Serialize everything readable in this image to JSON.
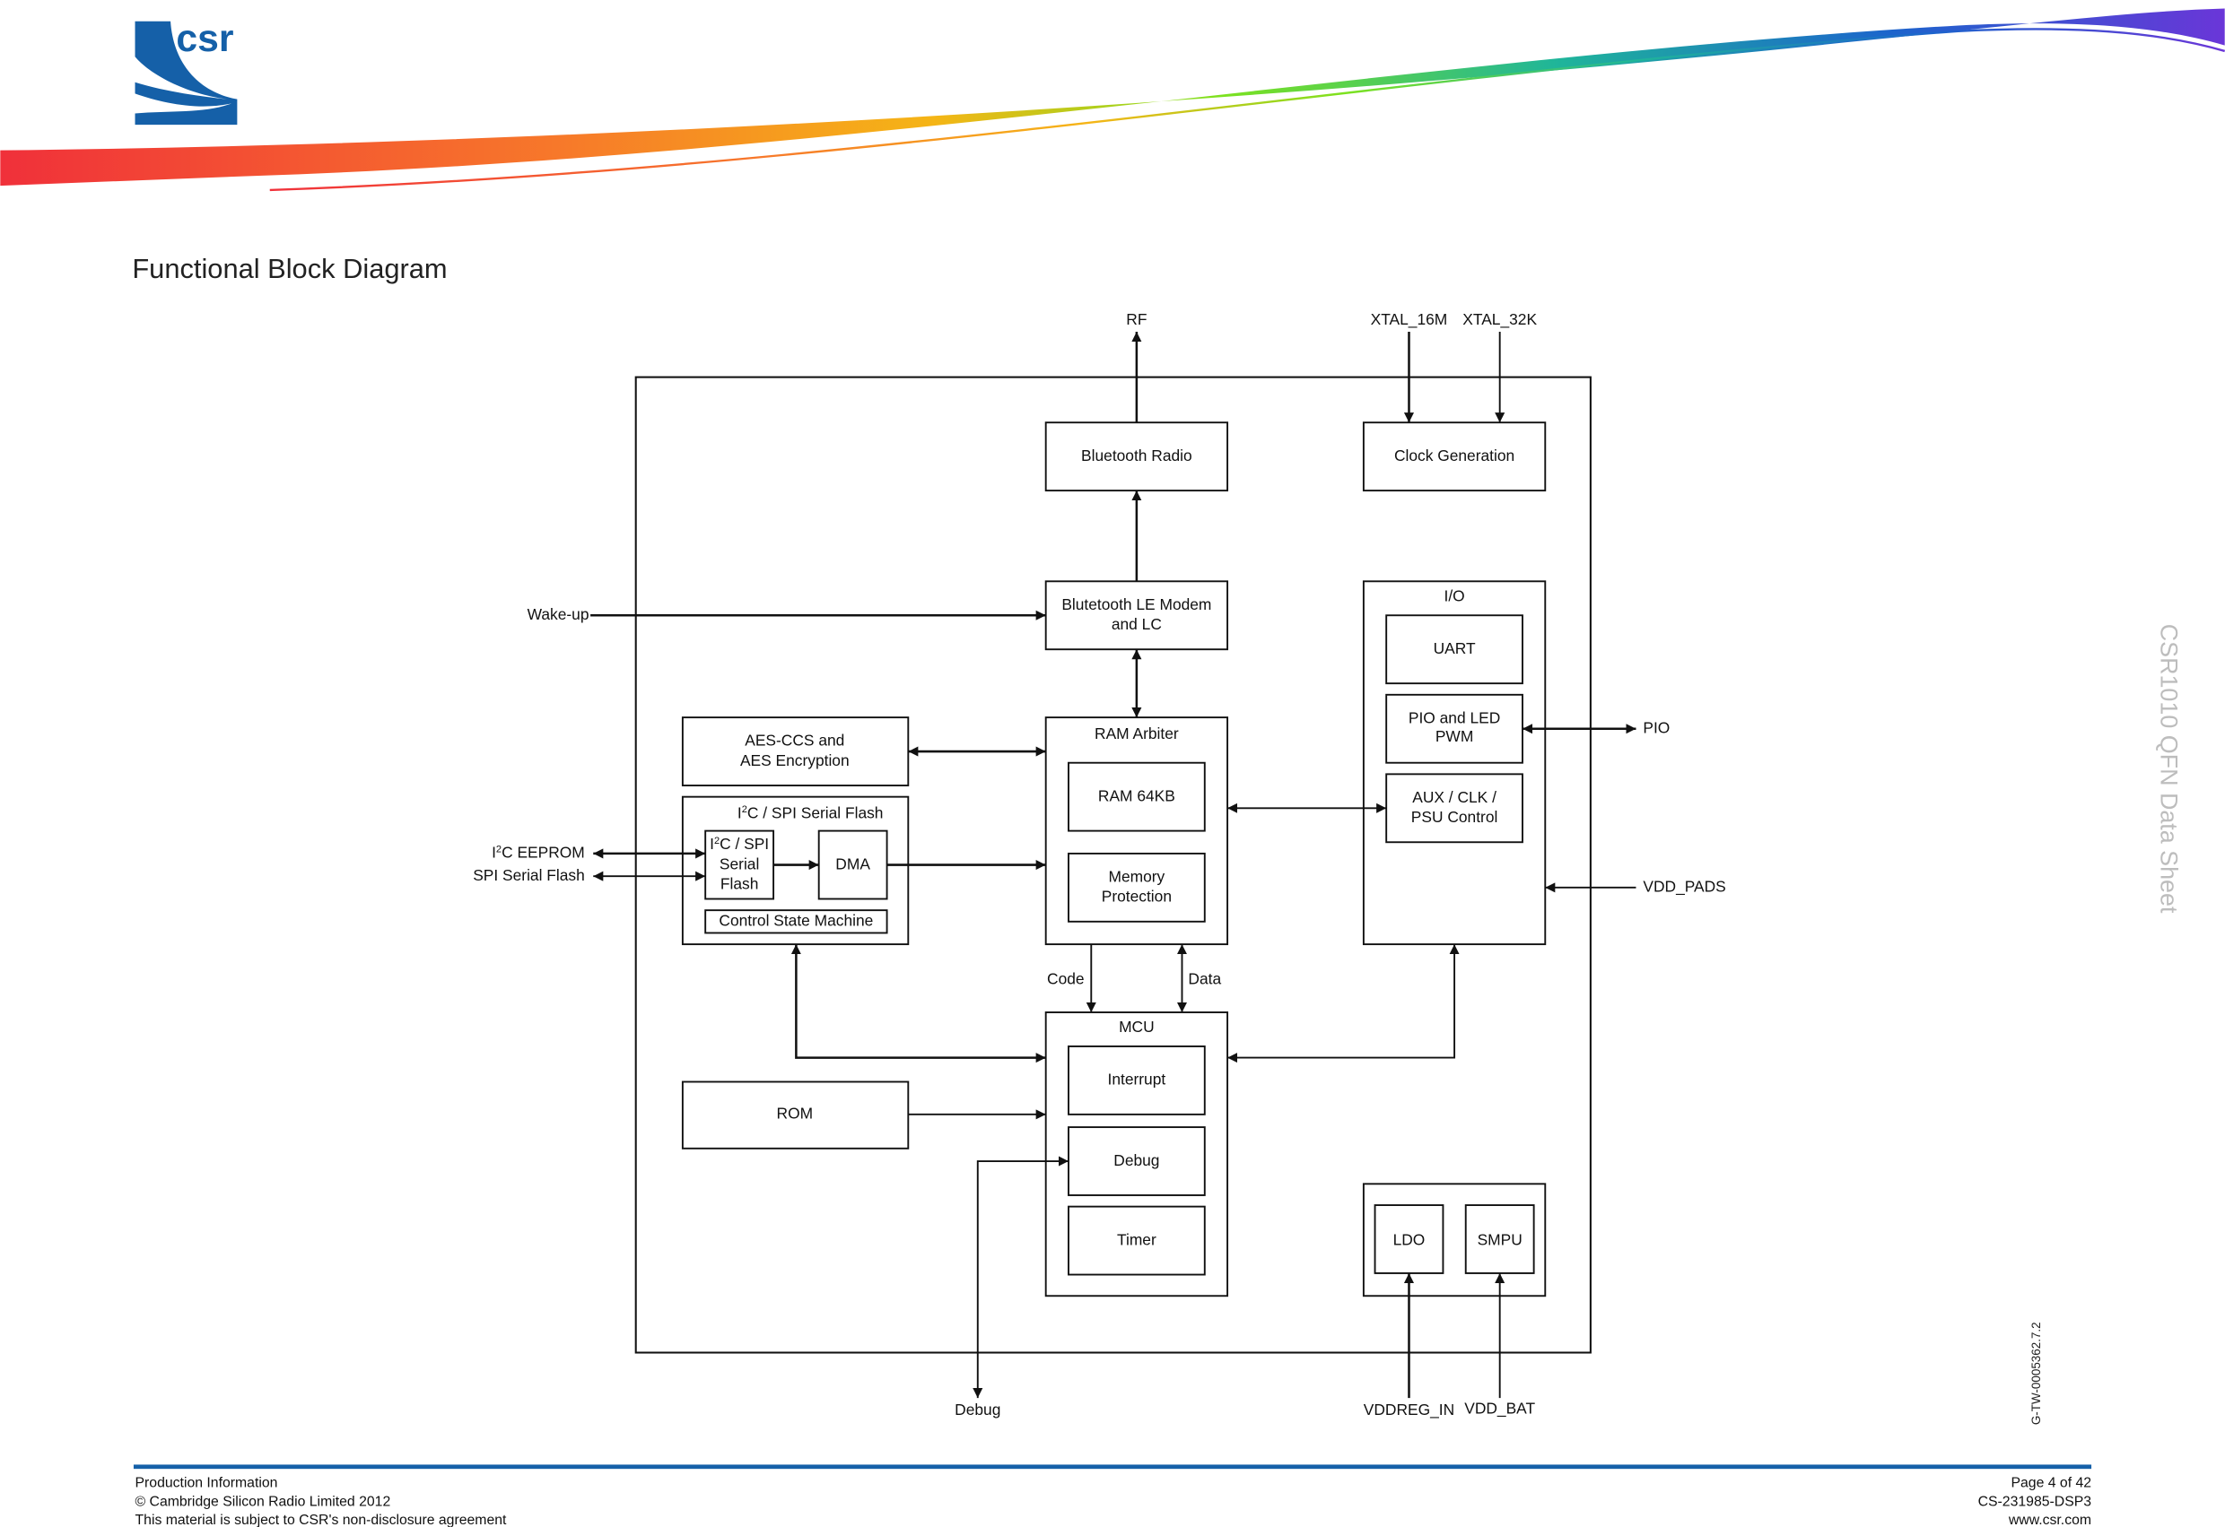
{
  "header": {
    "logo_text": "csr",
    "brand_color": "#1560a8",
    "swoosh_colors": [
      "#f0303a",
      "#f7782a",
      "#f5b516",
      "#7ce21f",
      "#1fb59a",
      "#1c64cc",
      "#6a36d8"
    ]
  },
  "page_title": "Functional Block Diagram",
  "side_title": "CSR1010 QFN  Data Sheet",
  "figure_id": "G-TW-0005362.7.2",
  "diagram": {
    "external_signals": {
      "rf": "RF",
      "xtal_16m": "XTAL_16M",
      "xtal_32k": "XTAL_32K",
      "wake_up": "Wake-up",
      "i2c_eeprom_prefix": "I",
      "i2c_eeprom_sup": "2",
      "i2c_eeprom_suffix": "C EEPROM",
      "spi_serial_flash": "SPI Serial Flash",
      "pio": "PIO",
      "vdd_pads": "VDD_PADS",
      "debug": "Debug",
      "vddreg_in": "VDDREG_IN",
      "vdd_bat": "VDD_BAT"
    },
    "blocks": {
      "bluetooth_radio": "Bluetooth Radio",
      "clock_generation": "Clock Generation",
      "le_modem_line1": "Blutetooth LE Modem",
      "le_modem_line2": "and LC",
      "io": "I/O",
      "uart": "UART",
      "pio_led_line1": "PIO and LED",
      "pio_led_line2": "PWM",
      "aux_line1": "AUX / CLK /",
      "aux_line2": "PSU Control",
      "aes_line1": "AES-CCS and",
      "aes_line2": "AES Encryption",
      "serial_flash_group_prefix": "I",
      "serial_flash_group_sup": "2",
      "serial_flash_group_suffix": "C / SPI Serial Flash",
      "serial_flash_line1_prefix": "I",
      "serial_flash_line1_sup": "2",
      "serial_flash_line1_suffix": "C / SPI",
      "serial_flash_line2": "Serial",
      "serial_flash_line3": "Flash",
      "dma": "DMA",
      "control_state_machine": "Control State Machine",
      "ram_arbiter": "RAM Arbiter",
      "ram": "RAM 64KB",
      "mem_prot_line1": "Memory",
      "mem_prot_line2": "Protection",
      "code": "Code",
      "data": "Data",
      "mcu": "MCU",
      "interrupt": "Interrupt",
      "debug": "Debug",
      "timer": "Timer",
      "rom": "ROM",
      "ldo": "LDO",
      "smpu": "SMPU"
    }
  },
  "footer": {
    "rule_color": "#1560a8",
    "left": [
      "Production Information",
      "© Cambridge Silicon Radio Limited 2012",
      "This material is subject to CSR's non-disclosure agreement"
    ],
    "right": [
      "Page 4 of 42",
      "CS-231985-DSP3",
      "www.csr.com"
    ]
  }
}
